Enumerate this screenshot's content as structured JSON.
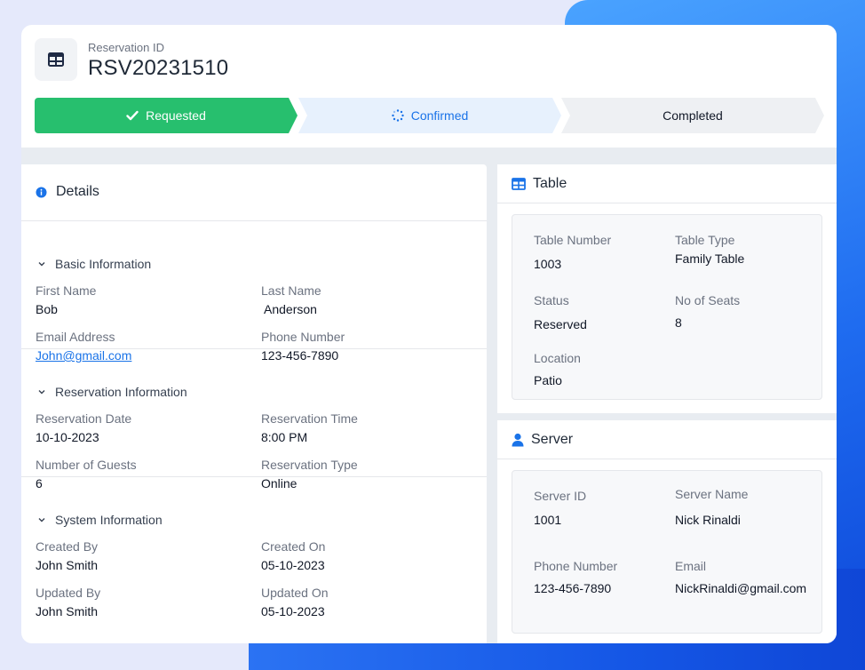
{
  "header": {
    "label": "Reservation ID",
    "id": "RSV20231510",
    "icon": "table-grid-icon"
  },
  "steps": [
    {
      "label": "Requested",
      "state": "done",
      "icon": "check-icon",
      "color": "#27bf6e"
    },
    {
      "label": "Confirmed",
      "state": "active",
      "icon": "spinner-icon",
      "color": "#1a73e8"
    },
    {
      "label": "Completed",
      "state": "pending",
      "icon": "",
      "color": "#eef0f3"
    }
  ],
  "details": {
    "title": "Details",
    "sections": {
      "basic": {
        "title": "Basic Information",
        "first_name_label": "First Name",
        "first_name": "Bob",
        "last_name_label": "Last Name",
        "last_name": "Anderson",
        "email_label": "Email Address",
        "email": "John@gmail.com",
        "phone_label": "Phone Number",
        "phone": "123-456-7890"
      },
      "reservation": {
        "title": "Reservation Information",
        "date_label": "Reservation Date",
        "date": "10-10-2023",
        "time_label": "Reservation Time",
        "time": "8:00 PM",
        "guests_label": "Number of Guests",
        "guests": "6",
        "type_label": "Reservation Type",
        "type": "Online"
      },
      "system": {
        "title": "System Information",
        "created_by_label": "Created By",
        "created_by": "John Smith",
        "created_on_label": "Created On",
        "created_on": "05-10-2023",
        "updated_by_label": "Updated By",
        "updated_by": "John Smith",
        "updated_on_label": "Updated On",
        "updated_on": "05-10-2023"
      }
    }
  },
  "table_panel": {
    "title": "Table",
    "number_label": "Table Number",
    "number": "1003",
    "type_label": "Table Type",
    "type": "Family Table",
    "status_label": "Status",
    "status": "Reserved",
    "seats_label": "No of Seats",
    "seats": "8",
    "location_label": "Location",
    "location": "Patio"
  },
  "server_panel": {
    "title": "Server",
    "id_label": "Server ID",
    "id": "1001",
    "name_label": "Server Name",
    "name": "Nick Rinaldi",
    "phone_label": "Phone Number",
    "phone": "123-456-7890",
    "email_label": "Email",
    "email": "NickRinaldi@gmail.com"
  },
  "colors": {
    "accent": "#1a73e8",
    "success": "#27bf6e",
    "background_blue": "#1f6cf0"
  }
}
